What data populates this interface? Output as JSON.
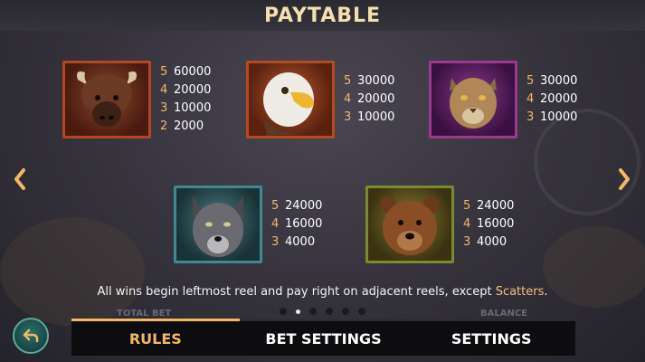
{
  "header": {
    "title": "PAYTABLE"
  },
  "symbols": [
    {
      "name": "buffalo",
      "frame_color": "#b34722",
      "pays": [
        {
          "count": "5",
          "amount": "60000"
        },
        {
          "count": "4",
          "amount": "20000"
        },
        {
          "count": "3",
          "amount": "10000"
        },
        {
          "count": "2",
          "amount": "2000"
        }
      ]
    },
    {
      "name": "eagle",
      "frame_color": "#b54a1c",
      "pays": [
        {
          "count": "5",
          "amount": "30000"
        },
        {
          "count": "4",
          "amount": "20000"
        },
        {
          "count": "3",
          "amount": "10000"
        }
      ]
    },
    {
      "name": "cougar",
      "frame_color": "#9b3a8a",
      "pays": [
        {
          "count": "5",
          "amount": "30000"
        },
        {
          "count": "4",
          "amount": "20000"
        },
        {
          "count": "3",
          "amount": "10000"
        }
      ]
    },
    {
      "name": "wolf",
      "frame_color": "#3e8a92",
      "pays": [
        {
          "count": "5",
          "amount": "24000"
        },
        {
          "count": "4",
          "amount": "16000"
        },
        {
          "count": "3",
          "amount": "4000"
        }
      ]
    },
    {
      "name": "bear",
      "frame_color": "#7c8a2a",
      "pays": [
        {
          "count": "5",
          "amount": "24000"
        },
        {
          "count": "4",
          "amount": "16000"
        },
        {
          "count": "3",
          "amount": "4000"
        }
      ]
    }
  ],
  "rule": {
    "text": "All wins begin leftmost reel and pay right on adjacent reels, except ",
    "highlight": "Scatters",
    "end": "."
  },
  "pagination": {
    "count": 6,
    "active": 1
  },
  "background_labels": {
    "total_bet": "TOTAL BET",
    "balance": "BALANCE"
  },
  "tabs": [
    {
      "label": "RULES",
      "active": true
    },
    {
      "label": "BET SETTINGS",
      "active": false
    },
    {
      "label": "SETTINGS",
      "active": false
    }
  ],
  "icons": {
    "prev": "chevron-left-icon",
    "next": "chevron-right-icon",
    "back": "back-arrow-icon"
  },
  "colors": {
    "accent": "#f2b866",
    "scatter": "#f2c17a"
  }
}
